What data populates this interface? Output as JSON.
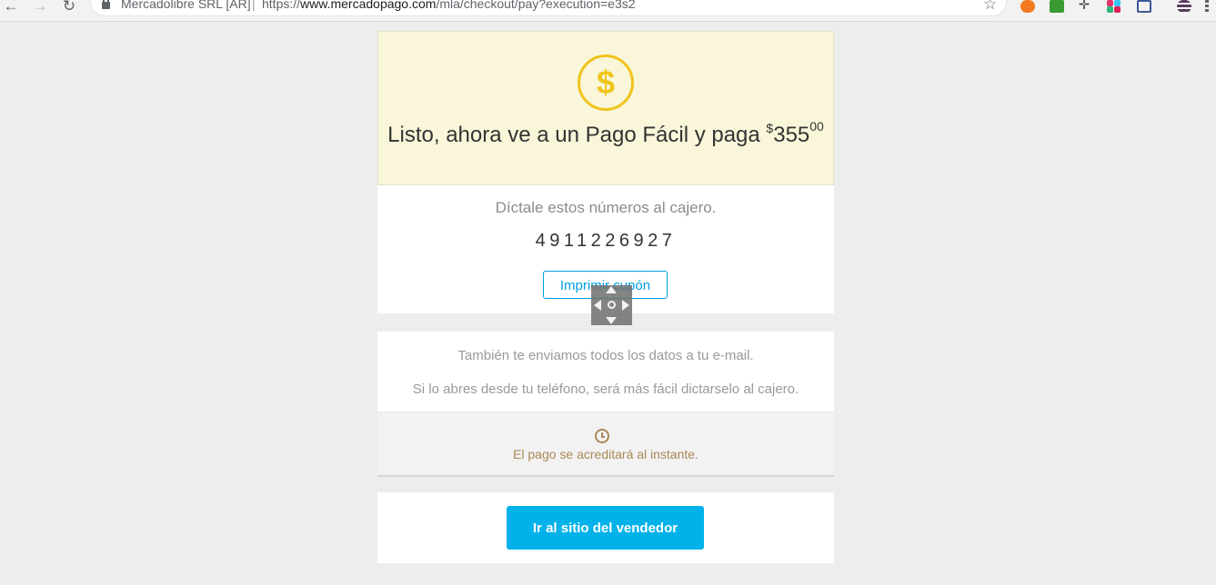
{
  "browser": {
    "origin": "Mercadolibre SRL [AR]",
    "url_separator": "|",
    "url_scheme": "https://",
    "url_host": "www.mercadopago.com",
    "url_path": "/mla/checkout/pay?execution=e3s2",
    "back_icon": "←",
    "forward_icon": "→",
    "reload_icon": "↻",
    "star_icon": "☆",
    "extension_cross_icon": "✛"
  },
  "hero": {
    "coin_symbol": "$",
    "title": "Listo, ahora ve a un Pago Fácil y paga ",
    "currency": "$",
    "amount_units": "355",
    "amount_cents": "00"
  },
  "code_box": {
    "instruction": "Díctale estos números al cajero.",
    "code": "4911226927",
    "print_button": "Imprimir cupón"
  },
  "email_box": {
    "line1": "También te enviamos todos los datos a tu e-mail.",
    "line2": "Si lo abres desde tu teléfono, será más fácil dictarselo al cajero.",
    "accredit": "El pago se acreditará al instante."
  },
  "actions": {
    "vendor_button": "Ir al sitio del vendedor"
  },
  "colors": {
    "page_bg": "#ededed",
    "hero_bg": "#f9f6d9",
    "coin": "#f0c41b",
    "link_blue": "#009ee3",
    "primary_button": "#00b1ea",
    "accredit_text": "#a98858"
  }
}
